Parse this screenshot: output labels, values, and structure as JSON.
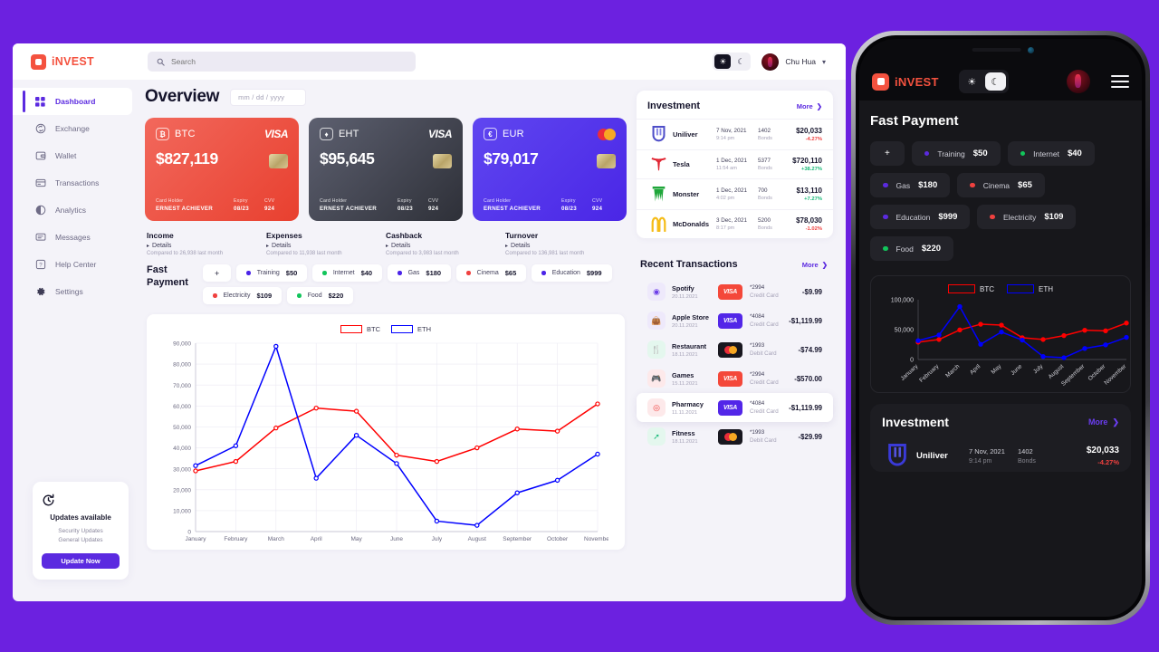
{
  "brand": {
    "name": "iNVEST",
    "logo_icon": "square-logo-icon",
    "color": "#f4523f"
  },
  "topbar": {
    "search_placeholder": "Search",
    "search_value": "",
    "search_icon": "search-icon",
    "light_icon": "sun-icon",
    "dark_icon": "moon-icon",
    "user_name": "Chu Hua",
    "caret_icon": "chevron-down-icon"
  },
  "sidebar": {
    "items": [
      {
        "label": "Dashboard",
        "icon": "grid-icon",
        "active": true
      },
      {
        "label": "Exchange",
        "icon": "exchange-icon",
        "active": false
      },
      {
        "label": "Wallet",
        "icon": "wallet-icon",
        "active": false
      },
      {
        "label": "Transactions",
        "icon": "card-icon",
        "active": false
      },
      {
        "label": "Analytics",
        "icon": "pie-chart-icon",
        "active": false
      },
      {
        "label": "Messages",
        "icon": "message-icon",
        "active": false
      },
      {
        "label": "Help Center",
        "icon": "help-icon",
        "active": false
      },
      {
        "label": "Settings",
        "icon": "gear-icon",
        "active": false
      }
    ],
    "update_card": {
      "icon": "refresh-clock-icon",
      "title": "Updates available",
      "line1": "Security Updates",
      "line2": "General Updates",
      "button": "Update Now"
    }
  },
  "overview": {
    "title": "Overview",
    "date_placeholder": "mm / dd / yyyy"
  },
  "cards": [
    {
      "symbol": "BTC",
      "symbol_glyph": "₿",
      "network": "VISA",
      "network_type": "visa",
      "amount": "$827,119",
      "holder_label": "Card Holder",
      "holder": "ERNEST ACHIEVER",
      "expiry_label": "Expiry",
      "expiry": "08/23",
      "cvv_label": "CVV",
      "cvv": "924",
      "theme": "btc"
    },
    {
      "symbol": "EHT",
      "symbol_glyph": "♦",
      "network": "VISA",
      "network_type": "visa",
      "amount": "$95,645",
      "holder_label": "Card Holder",
      "holder": "ERNEST ACHIEVER",
      "expiry_label": "Expiry",
      "expiry": "08/23",
      "cvv_label": "CVV",
      "cvv": "924",
      "theme": "eht"
    },
    {
      "symbol": "EUR",
      "symbol_glyph": "€",
      "network": "Mastercard",
      "network_type": "mastercard",
      "amount": "$79,017",
      "holder_label": "Card Holder",
      "holder": "ERNEST ACHIEVER",
      "expiry_label": "Expiry",
      "expiry": "08/23",
      "cvv_label": "CVV",
      "cvv": "924",
      "theme": "eur"
    }
  ],
  "stats": [
    {
      "title": "Income",
      "details": "Details",
      "compare": "Compared to 26,938 last month"
    },
    {
      "title": "Expenses",
      "details": "Details",
      "compare": "Compared to 11,938 last month"
    },
    {
      "title": "Cashback",
      "details": "Details",
      "compare": "Compared to 3,983 last month"
    },
    {
      "title": "Turnover",
      "details": "Details",
      "compare": "Compared to 136,981 last month"
    }
  ],
  "fast_payment": {
    "title": "Fast Payment",
    "add_label": "+",
    "items": [
      {
        "label": "Training",
        "amount": "$50",
        "color": "#4b24e8"
      },
      {
        "label": "Internet",
        "amount": "$40",
        "color": "#12c55b"
      },
      {
        "label": "Gas",
        "amount": "$180",
        "color": "#4b24e8"
      },
      {
        "label": "Cinema",
        "amount": "$65",
        "color": "#f0413f"
      },
      {
        "label": "Education",
        "amount": "$999",
        "color": "#4b24e8"
      },
      {
        "label": "Electricity",
        "amount": "$109",
        "color": "#f0413f"
      },
      {
        "label": "Food",
        "amount": "$220",
        "color": "#12c55b"
      }
    ]
  },
  "chart_data": {
    "type": "line",
    "title": "",
    "xlabel": "",
    "ylabel": "",
    "grid": true,
    "legend_position": "top-center",
    "ylim": [
      0,
      90000
    ],
    "yticks": [
      0,
      10000,
      20000,
      30000,
      40000,
      50000,
      60000,
      70000,
      80000,
      90000
    ],
    "ytick_labels": [
      "0",
      "10,000",
      "20,000",
      "30,000",
      "40,000",
      "50,000",
      "60,000",
      "70,000",
      "80,000",
      "90,000"
    ],
    "categories": [
      "January",
      "February",
      "March",
      "April",
      "May",
      "June",
      "July",
      "August",
      "September",
      "October",
      "November"
    ],
    "series": [
      {
        "name": "BTC",
        "color": "#ff0000",
        "values": [
          29000,
          33500,
          49500,
          59000,
          57500,
          36500,
          33500,
          40000,
          49000,
          48000,
          61000
        ]
      },
      {
        "name": "ETH",
        "color": "#0000ff",
        "values": [
          31500,
          41000,
          88500,
          25500,
          46000,
          32500,
          5000,
          3000,
          18500,
          24500,
          37000
        ]
      }
    ]
  },
  "phone_chart_data": {
    "type": "line",
    "ylim": [
      0,
      100000
    ],
    "yticks": [
      0,
      50000,
      100000
    ],
    "ytick_labels": [
      "0",
      "50,000",
      "100,000"
    ],
    "categories": [
      "January",
      "February",
      "March",
      "April",
      "May",
      "June",
      "July",
      "August",
      "September",
      "October",
      "November"
    ],
    "series": [
      {
        "name": "BTC",
        "color": "#ff0000",
        "values": [
          29000,
          33500,
          49500,
          59000,
          57500,
          36500,
          33500,
          40000,
          49000,
          48000,
          61000
        ]
      },
      {
        "name": "ETH",
        "color": "#0000ff",
        "values": [
          31500,
          41000,
          88500,
          25500,
          46000,
          32500,
          5000,
          3000,
          18500,
          24500,
          37000
        ]
      }
    ]
  },
  "investment": {
    "title": "Investment",
    "more": "More",
    "more_icon": "chevron-right-icon",
    "rows": [
      {
        "logo": "unilever-logo-icon",
        "name": "Uniliver",
        "date": "7 Nov, 2021",
        "time": "9:14 pm",
        "bonds": "1402",
        "bonds_label": "Bonds",
        "value": "$20,033",
        "change": "-4.27%",
        "dir": "down"
      },
      {
        "logo": "tesla-logo-icon",
        "name": "Tesla",
        "date": "1 Dec, 2021",
        "time": "11:54 am",
        "bonds": "5377",
        "bonds_label": "Bonds",
        "value": "$720,110",
        "change": "+38.27%",
        "dir": "up"
      },
      {
        "logo": "monster-logo-icon",
        "name": "Monster",
        "date": "1 Dec, 2021",
        "time": "4:02 pm",
        "bonds": "700",
        "bonds_label": "Bonds",
        "value": "$13,110",
        "change": "+7.27%",
        "dir": "up"
      },
      {
        "logo": "mcdonalds-logo-icon",
        "name": "McDonalds",
        "date": "3 Dec, 2021",
        "time": "8:17 pm",
        "bonds": "5200",
        "bonds_label": "Bonds",
        "value": "$78,030",
        "change": "-1.02%",
        "dir": "down"
      }
    ]
  },
  "transactions": {
    "title": "Recent Transactions",
    "more": "More",
    "more_icon": "chevron-right-icon",
    "rows": [
      {
        "icon": "spotify-icon",
        "icon_bg": "#eee9fb",
        "icon_color": "#6b3ce8",
        "name": "Spotify",
        "date": "20.11.2021",
        "card": "visa-red",
        "card_text": "VISA",
        "number": "*2994",
        "type": "Credit Card",
        "amount": "-$9.99",
        "highlight": false
      },
      {
        "icon": "apple-bag-icon",
        "icon_bg": "#eee9fb",
        "icon_color": "#6b3ce8",
        "name": "Apple Store",
        "date": "20.11.2021",
        "card": "visa-blue",
        "card_text": "VISA",
        "number": "*4084",
        "type": "Credit Card",
        "amount": "-$1,119.99",
        "highlight": false
      },
      {
        "icon": "restaurant-icon",
        "icon_bg": "#e4f7ee",
        "icon_color": "#17b978",
        "name": "Restaurant",
        "date": "18.11.2021",
        "card": "mc",
        "card_text": "",
        "number": "*1993",
        "type": "Debit Card",
        "amount": "-$74.99",
        "highlight": false
      },
      {
        "icon": "gamepad-icon",
        "icon_bg": "#fde9ea",
        "icon_color": "#f0413f",
        "name": "Games",
        "date": "15.11.2021",
        "card": "visa-red",
        "card_text": "VISA",
        "number": "*2994",
        "type": "Credit Card",
        "amount": "-$570.00",
        "highlight": false
      },
      {
        "icon": "pharmacy-icon",
        "icon_bg": "#fde9ea",
        "icon_color": "#f0413f",
        "name": "Pharmacy",
        "date": "11.11.2021",
        "card": "visa-blue",
        "card_text": "VISA",
        "number": "*4084",
        "type": "Credit Card",
        "amount": "-$1,119.99",
        "highlight": true
      },
      {
        "icon": "fitness-icon",
        "icon_bg": "#e4f7ee",
        "icon_color": "#17b978",
        "name": "Fitness",
        "date": "18.11.2021",
        "card": "mc",
        "card_text": "",
        "number": "*1993",
        "type": "Debit Card",
        "amount": "-$29.99",
        "highlight": false
      }
    ]
  },
  "phone": {
    "brand": "iNVEST",
    "light_icon": "sun-icon",
    "dark_icon": "moon-icon",
    "menu_icon": "hamburger-menu-icon",
    "fast_payment_title": "Fast Payment",
    "add_label": "+",
    "chips": [
      {
        "label": "Training",
        "amount": "$50",
        "color": "#5b2ae0"
      },
      {
        "label": "Internet",
        "amount": "$40",
        "color": "#12c55b"
      },
      {
        "label": "Gas",
        "amount": "$180",
        "color": "#5b2ae0"
      },
      {
        "label": "Cinema",
        "amount": "$65",
        "color": "#f0413f"
      },
      {
        "label": "Education",
        "amount": "$999",
        "color": "#5b2ae0"
      },
      {
        "label": "Electricity",
        "amount": "$109",
        "color": "#f0413f"
      },
      {
        "label": "Food",
        "amount": "$220",
        "color": "#12c55b"
      }
    ],
    "investment_title": "Investment",
    "more": "More",
    "inv_row": {
      "logo": "unilever-logo-icon",
      "name": "Uniliver",
      "date": "7 Nov, 2021",
      "time": "9:14 pm",
      "bonds": "1402",
      "bonds_label": "Bonds",
      "value": "$20,033",
      "change": "-4.27%"
    }
  }
}
